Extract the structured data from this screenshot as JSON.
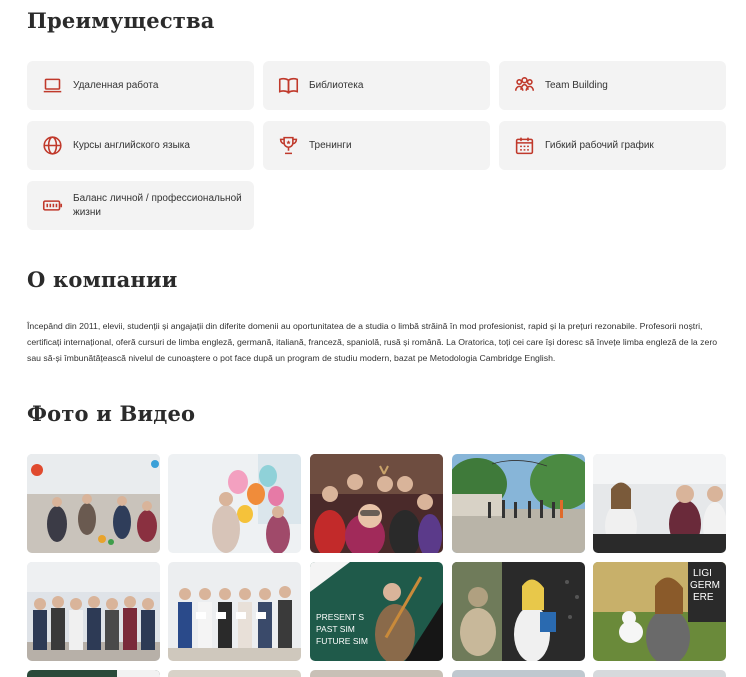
{
  "benefits": {
    "title": "Преимущества",
    "items": [
      {
        "label": "Удаленная работа",
        "icon": "laptop-icon"
      },
      {
        "label": "Библиотека",
        "icon": "book-icon"
      },
      {
        "label": "Team Building",
        "icon": "team-icon"
      },
      {
        "label": "Курсы английского языка",
        "icon": "globe-icon"
      },
      {
        "label": "Тренинги",
        "icon": "trophy-icon"
      },
      {
        "label": "Гибкий рабочий график",
        "icon": "calendar-icon"
      },
      {
        "label": "Баланс личной / профессиональной жизни",
        "icon": "battery-icon"
      }
    ]
  },
  "about": {
    "title": "О компании",
    "text": "Începând din 2011, elevii, studenții și angajații din diferite domenii au oportunitatea de a studia o limbă străină în mod profesionist, rapid și la prețuri rezonabile. Profesorii noștri, certificați internațional, oferă cursuri de limba engleză, germană, italiană, franceză, spaniolă, rusă și română. La Oratorica, toți cei care își doresc să învețe limba engleză de la zero sau să-și îmbunătățească nivelul de cunoaștere o pot face după un program de studiu modern, bazat pe Metodologia Cambridge English."
  },
  "media": {
    "title": "Фото и Видео",
    "photo_texts": {
      "present": "PRESENT S",
      "past": "PAST SIM",
      "future": "FUTURE SIM",
      "side1": "LIGI",
      "side2": "GERM",
      "side3": "ERE"
    }
  },
  "colors": {
    "accent": "#c0392b",
    "card_bg": "#f3f3f3"
  }
}
